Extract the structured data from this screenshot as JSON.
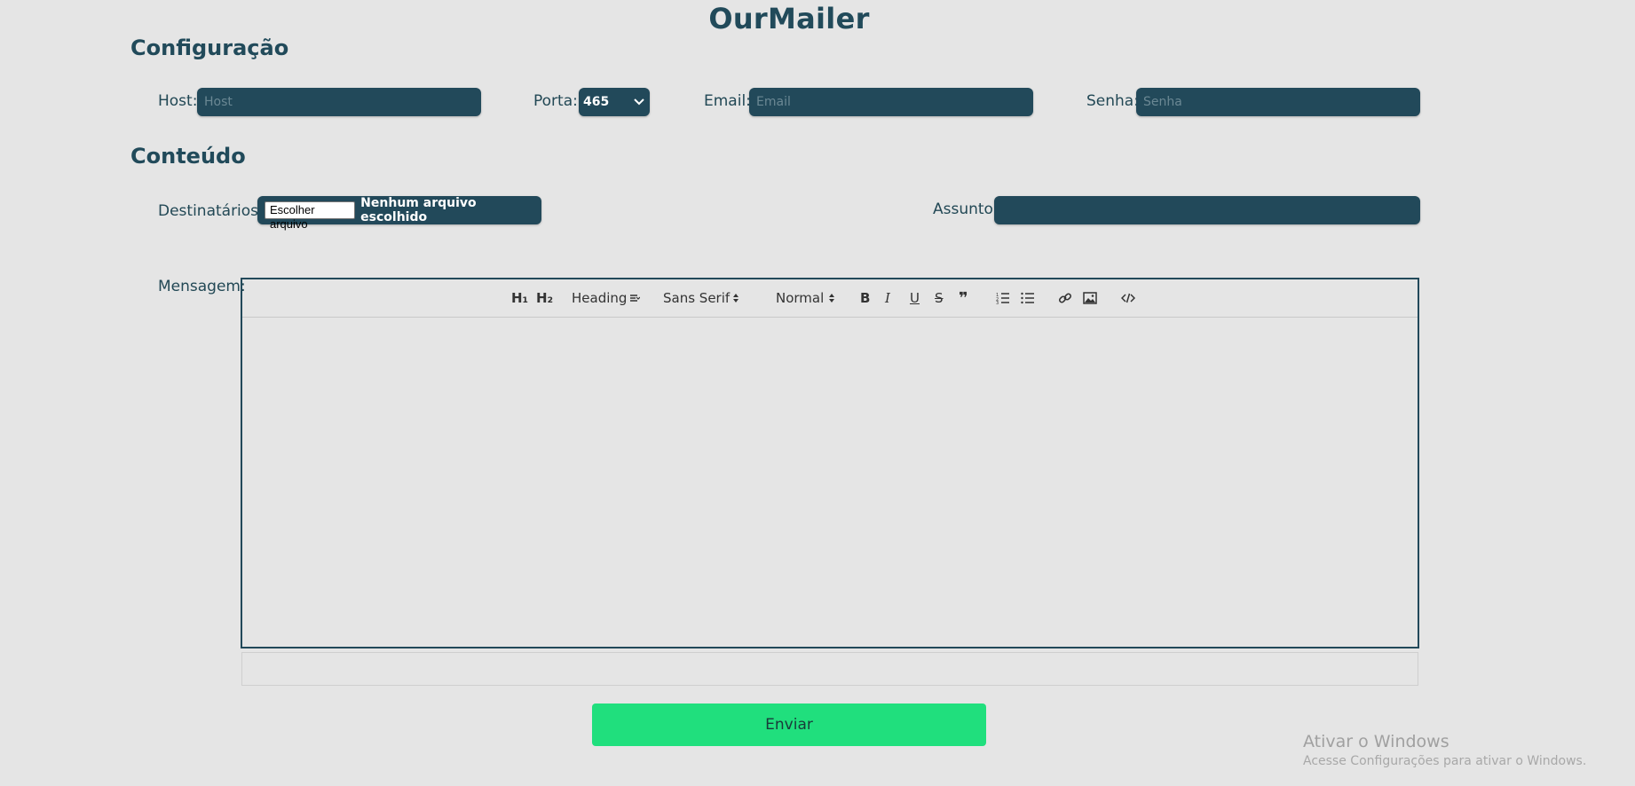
{
  "app": {
    "title": "OurMailer"
  },
  "config": {
    "title": "Configuração",
    "host": {
      "label": "Host:",
      "placeholder": "Host",
      "value": ""
    },
    "port": {
      "label": "Porta:",
      "selected": "465"
    },
    "email": {
      "label": "Email:",
      "placeholder": "Email",
      "value": ""
    },
    "password": {
      "label": "Senha:",
      "placeholder": "Senha",
      "value": ""
    }
  },
  "content": {
    "title": "Conteúdo",
    "recipients": {
      "label": "Destinatários:",
      "button": "Escolher arquivo",
      "status": "Nenhum arquivo escolhido"
    },
    "subject": {
      "label": "Assunto:",
      "value": ""
    },
    "message": {
      "label": "Mensagem:"
    }
  },
  "toolbar": {
    "h1": "H₁",
    "h2": "H₂",
    "heading": "Heading",
    "font": "Sans Serif",
    "size": "Normal",
    "bold": "B",
    "italic": "I",
    "underline": "U",
    "strike": "S",
    "quote": "❞",
    "icons": [
      "ordered-list-icon",
      "bullet-list-icon",
      "link-icon",
      "image-icon",
      "code-icon"
    ]
  },
  "actions": {
    "send": "Enviar"
  },
  "watermark": {
    "line1": "Ativar o Windows",
    "line2": "Acesse Configurações para ativar o Windows."
  },
  "colors": {
    "background": "#e5e5e5",
    "field": "#22495a",
    "accent": "#20df7d",
    "title": "#214a5a"
  }
}
